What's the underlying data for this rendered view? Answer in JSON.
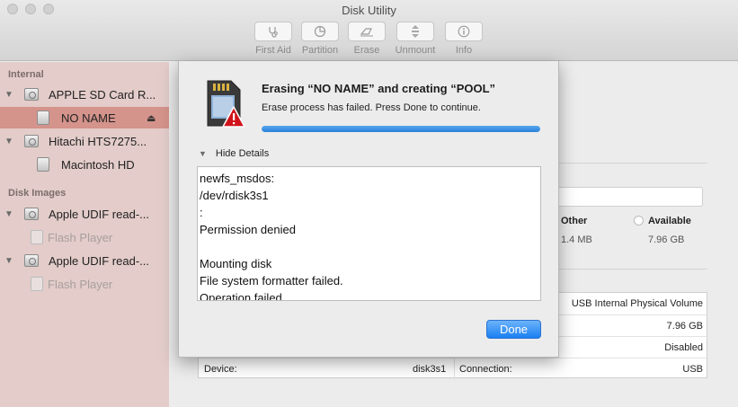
{
  "window": {
    "title": "Disk Utility"
  },
  "toolbar": {
    "items": [
      {
        "label": "First Aid",
        "icon": "stethoscope-icon"
      },
      {
        "label": "Partition",
        "icon": "pie-chart-icon"
      },
      {
        "label": "Erase",
        "icon": "eraser-icon"
      },
      {
        "label": "Unmount",
        "icon": "unmount-icon"
      },
      {
        "label": "Info",
        "icon": "info-icon"
      }
    ]
  },
  "sidebar": {
    "internal_header": "Internal",
    "disk_images_header": "Disk Images",
    "items": [
      {
        "label": "APPLE SD Card R..."
      },
      {
        "label": "NO NAME"
      },
      {
        "label": "Hitachi HTS7275..."
      },
      {
        "label": "Macintosh HD"
      },
      {
        "label": "Apple UDIF read-..."
      },
      {
        "label": "Flash Player"
      },
      {
        "label": "Apple UDIF read-..."
      },
      {
        "label": "Flash Player"
      }
    ],
    "selected_color": "#d4938b",
    "background_color": "#e3ccc9"
  },
  "main": {
    "legend": [
      {
        "label": "Other",
        "value": "1.4 MB"
      },
      {
        "label": "Available",
        "value": "7.96 GB"
      }
    ],
    "info_rows": [
      {
        "left_label": "",
        "left_value": "",
        "right_label": "",
        "right_value": "USB Internal Physical Volume"
      },
      {
        "left_label": "",
        "left_value": "",
        "right_label": "",
        "right_value": "7.96 GB"
      },
      {
        "left_label": "",
        "left_value": "",
        "right_label": "",
        "right_value": "Disabled"
      },
      {
        "left_label": "Device:",
        "left_value": "disk3s1",
        "right_label": "Connection:",
        "right_value": "USB"
      }
    ]
  },
  "sheet": {
    "title": "Erasing “NO NAME” and creating “POOL”",
    "message": "Erase process has failed. Press Done to continue.",
    "progress": 1.0,
    "details_toggle": "Hide Details",
    "log_lines": [
      "newfs_msdos:",
      "/dev/rdisk3s1",
      ":",
      "Permission denied",
      "",
      "Mounting disk",
      "File system formatter failed.",
      "Operation failed…"
    ],
    "done_label": "Done",
    "accent_color": "#1b7ff2",
    "error_badge_color": "#d0131b"
  }
}
